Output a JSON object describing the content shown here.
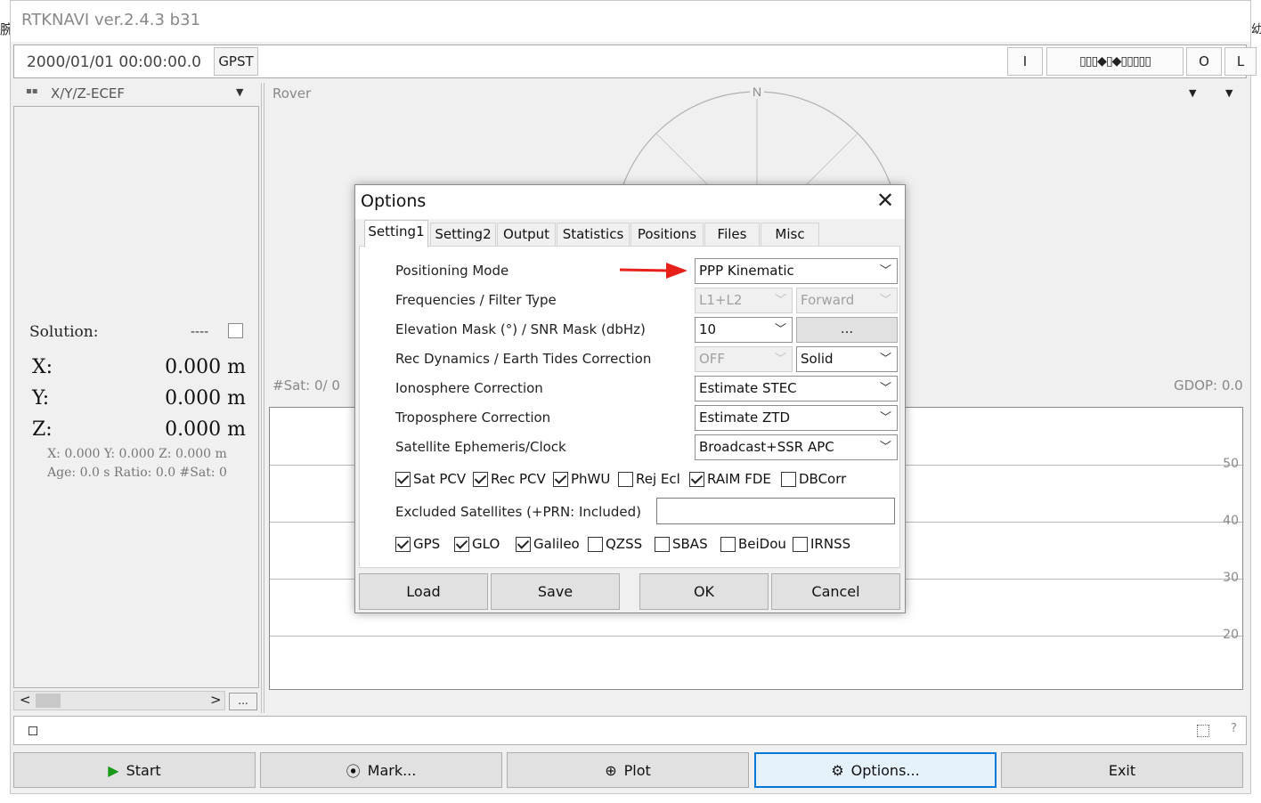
{
  "window": {
    "title": "RTKNAVI ver.2.4.3 b31"
  },
  "time_bar": {
    "time": "2000/01/01 00:00:00.0",
    "system": "GPST",
    "btn_i": "I",
    "stream_indicator": "▯▯▯◆▯◆▯▯▯▯▯",
    "btn_o": "O",
    "btn_l": "L"
  },
  "left_panel": {
    "coord_type": "X/Y/Z-ECEF",
    "solution_label": "Solution:",
    "solution_status": "----",
    "x_label": "X:",
    "x_value": "0.000 m",
    "y_label": "Y:",
    "y_value": "0.000 m",
    "z_label": "Z:",
    "z_value": "0.000 m",
    "xyz_small": "X: 0.000 Y: 0.000 Z: 0.000 m",
    "age_line": "Age: 0.0 s Ratio: 0.0 #Sat: 0",
    "more_btn": "..."
  },
  "right_panel": {
    "rover_label": "Rover",
    "skyplot_north": "N",
    "nsat": "#Sat: 0/ 0",
    "gdop": "GDOP: 0.0",
    "snr_ticks": [
      "50",
      "40",
      "30",
      "20"
    ]
  },
  "status_bar": {
    "help_icon": "?"
  },
  "bottom_buttons": {
    "start": "Start",
    "mark": "Mark...",
    "plot": "Plot",
    "options": "Options...",
    "exit": "Exit"
  },
  "dialog": {
    "title": "Options",
    "tabs": [
      "Setting1",
      "Setting2",
      "Output",
      "Statistics",
      "Positions",
      "Files",
      "Misc"
    ],
    "fields": {
      "positioning_mode": {
        "label": "Positioning Mode",
        "value": "PPP Kinematic"
      },
      "frequencies": {
        "label": "Frequencies / Filter Type",
        "value1": "L1+L2",
        "value2": "Forward"
      },
      "elevation": {
        "label": "Elevation Mask (°) / SNR Mask (dbHz)",
        "value": "10",
        "button": "..."
      },
      "rec_dynamics": {
        "label": "Rec Dynamics / Earth Tides Correction",
        "value1": "OFF",
        "value2": "Solid"
      },
      "ionosphere": {
        "label": "Ionosphere Correction",
        "value": "Estimate STEC"
      },
      "troposphere": {
        "label": "Troposphere Correction",
        "value": "Estimate ZTD"
      },
      "ephemeris": {
        "label": "Satellite Ephemeris/Clock",
        "value": "Broadcast+SSR APC"
      },
      "excluded": {
        "label": "Excluded Satellites (+PRN: Included)",
        "value": ""
      }
    },
    "options_checks": [
      {
        "label": "Sat PCV",
        "checked": true
      },
      {
        "label": "Rec PCV",
        "checked": true
      },
      {
        "label": "PhWU",
        "checked": true
      },
      {
        "label": "Rej Ecl",
        "checked": false
      },
      {
        "label": "RAIM FDE",
        "checked": true
      },
      {
        "label": "DBCorr",
        "checked": false
      }
    ],
    "system_checks": [
      {
        "label": "GPS",
        "checked": true
      },
      {
        "label": "GLO",
        "checked": true
      },
      {
        "label": "Galileo",
        "checked": true
      },
      {
        "label": "QZSS",
        "checked": false
      },
      {
        "label": "SBAS",
        "checked": false
      },
      {
        "label": "BeiDou",
        "checked": false
      },
      {
        "label": "IRNSS",
        "checked": false
      }
    ],
    "buttons": {
      "load": "Load",
      "save": "Save",
      "ok": "OK",
      "cancel": "Cancel"
    }
  },
  "colors": {
    "accent": "#0078d7",
    "arrow": "#e8201a",
    "start_icon": "#1a9a1a"
  }
}
